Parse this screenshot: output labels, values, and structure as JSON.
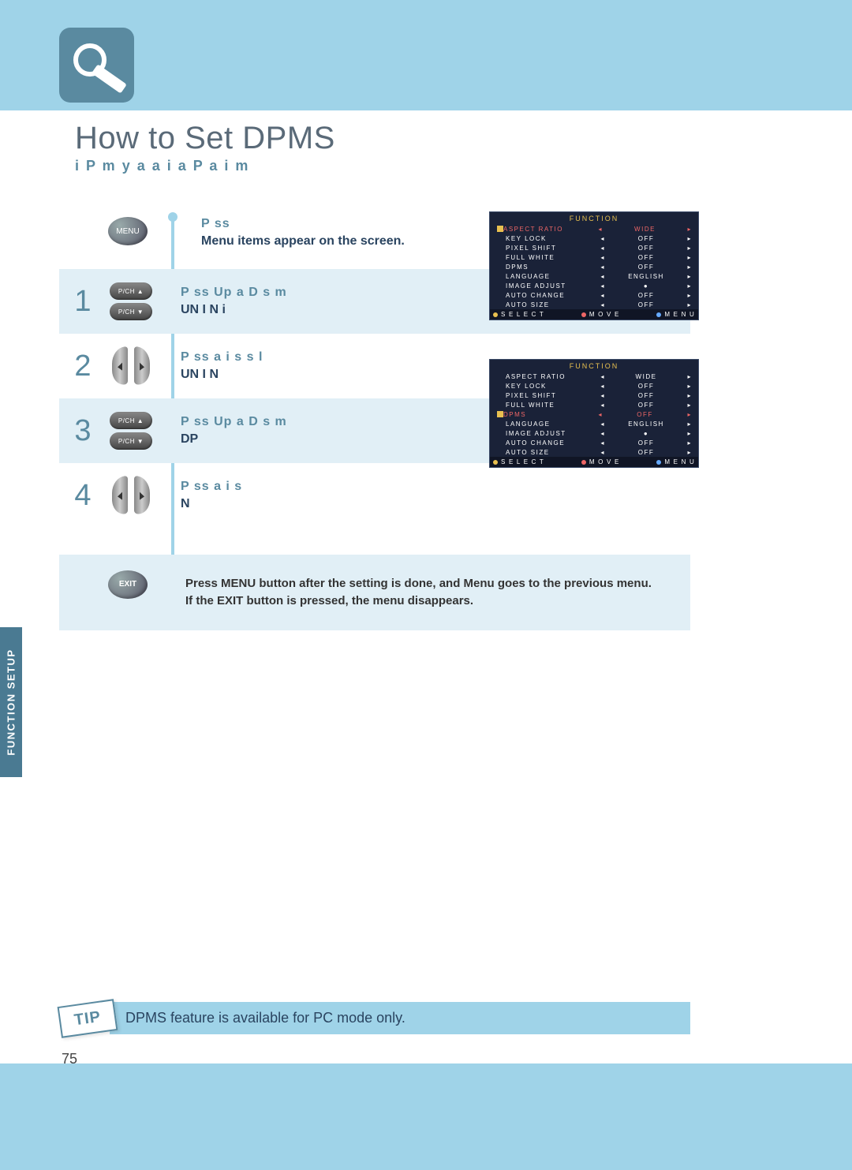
{
  "title": "How to Set DPMS",
  "subtitle": "i  P  m     y   a  a  i a   P       a  i   m",
  "side_tab": "FUNCTION SETUP",
  "page_number": "75",
  "step0": {
    "line1": "P  ss",
    "line2": "Menu items appear on the screen.",
    "button": "MENU"
  },
  "steps": [
    {
      "num": "1",
      "btns": [
        "P/CH ▲",
        "P/CH ▼"
      ],
      "line1": "P  ss Up a   D        s    m",
      "line2": "UN  I N i"
    },
    {
      "num": "2",
      "type": "lr",
      "line1": "P  ss     a   i        s    s l",
      "line2": "UN  I N"
    },
    {
      "num": "3",
      "btns": [
        "P/CH ▲",
        "P/CH ▼"
      ],
      "line1": "P  ss Up a   D        s    m",
      "line2": "DP"
    },
    {
      "num": "4",
      "type": "lr",
      "line1": "P  ss     a   i        s",
      "line2": " N "
    }
  ],
  "final": {
    "button": "EXIT",
    "line1": "Press MENU button after the setting is done, and Menu goes to the previous menu.",
    "line2": "If the EXIT button is pressed, the menu disappears."
  },
  "tip": {
    "badge": "TIP",
    "text": "DPMS feature is available for PC mode only."
  },
  "osd": {
    "title": "FUNCTION",
    "items": [
      {
        "label": "ASPECT  RATIO",
        "value": "WIDE"
      },
      {
        "label": "KEY  LOCK",
        "value": "OFF"
      },
      {
        "label": "PIXEL  SHIFT",
        "value": "OFF"
      },
      {
        "label": "FULL  WHITE",
        "value": "OFF"
      },
      {
        "label": "DPMS",
        "value": "OFF"
      },
      {
        "label": "LANGUAGE",
        "value": "ENGLISH"
      },
      {
        "label": "IMAGE  ADJUST",
        "value": "●"
      },
      {
        "label": "AUTO  CHANGE",
        "value": "OFF"
      },
      {
        "label": "AUTO  SIZE",
        "value": "OFF"
      }
    ],
    "footer": {
      "select": "S E L E C T",
      "move": "M O V E",
      "menu": "M E N U"
    },
    "highlight1": 0,
    "highlight2": 4
  }
}
